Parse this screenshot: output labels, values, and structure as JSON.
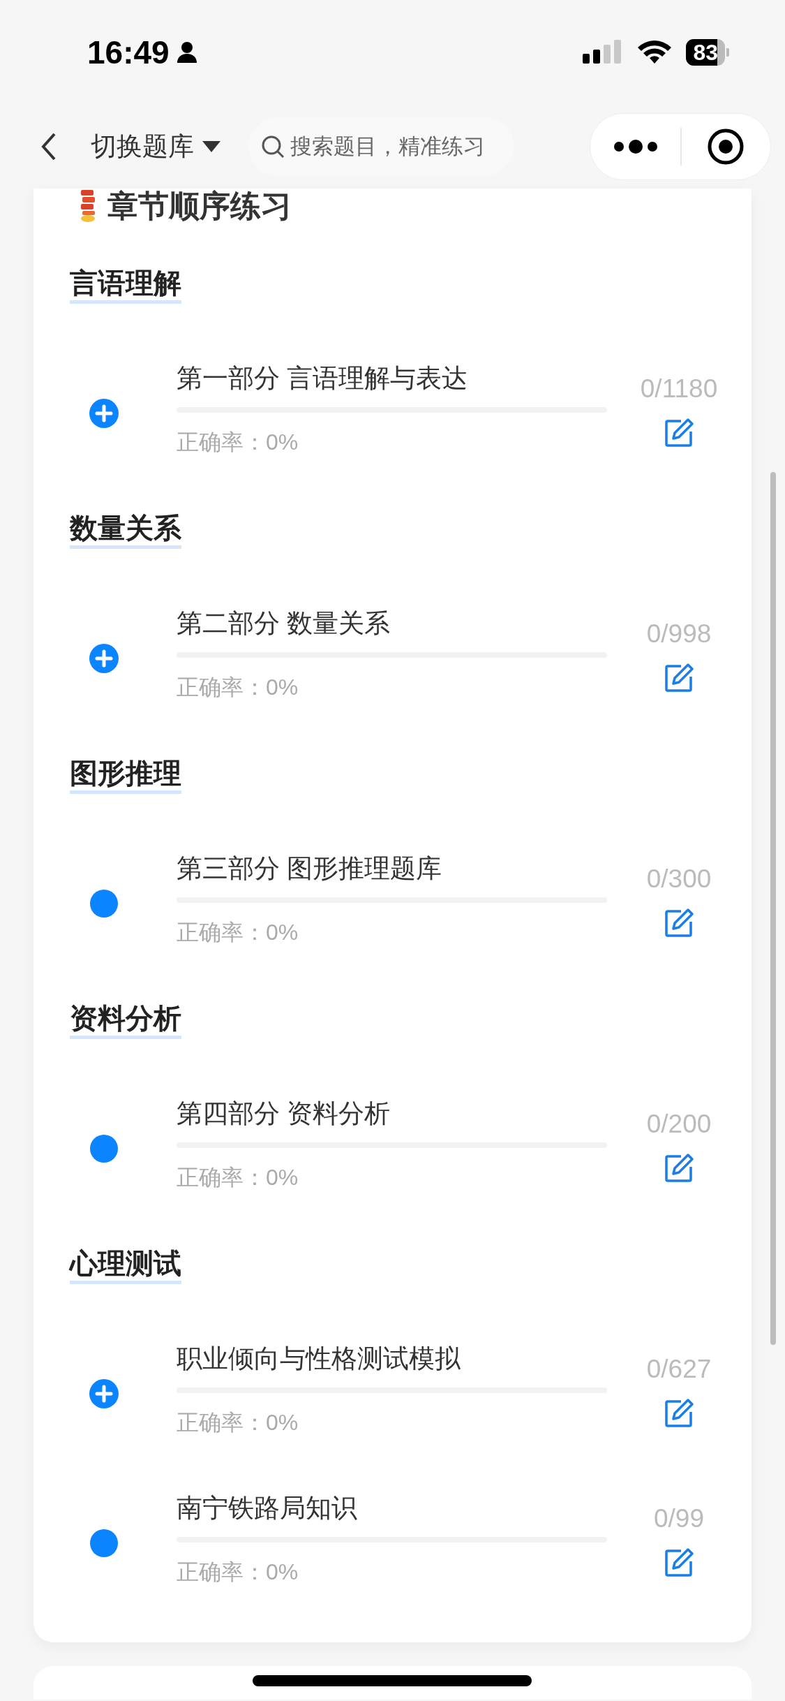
{
  "status_bar": {
    "time": "16:49",
    "battery": "83"
  },
  "nav": {
    "switch_label": "切换题库",
    "search": {
      "placeholder": "搜索题目，精准练习"
    }
  },
  "card": {
    "title": "章节顺序练习",
    "sections": [
      {
        "heading": "言语理解",
        "items": [
          {
            "title": "第一部分 言语理解与表达",
            "kind": "expandable",
            "level": 0,
            "accuracy": "正确率：0%",
            "count": "0/1180"
          }
        ]
      },
      {
        "heading": "数量关系",
        "items": [
          {
            "title": "第二部分 数量关系",
            "kind": "expandable",
            "level": 0,
            "accuracy": "正确率：0%",
            "count": "0/998"
          }
        ]
      },
      {
        "heading": "图形推理",
        "items": [
          {
            "title": "第三部分 图形推理题库",
            "kind": "leaf",
            "level": 0,
            "accuracy": "正确率：0%",
            "count": "0/300"
          }
        ]
      },
      {
        "heading": "资料分析",
        "items": [
          {
            "title": "第四部分 资料分析",
            "kind": "leaf",
            "level": 0,
            "accuracy": "正确率：0%",
            "count": "0/200"
          }
        ]
      },
      {
        "heading": "心理测试",
        "items": [
          {
            "title": "职业倾向与性格测试模拟",
            "kind": "expandable",
            "level": 0,
            "accuracy": "正确率：0%",
            "count": "0/627"
          },
          {
            "title": "南宁铁路局知识",
            "kind": "leaf",
            "level": 0,
            "accuracy": "正确率：0%",
            "count": "0/99"
          }
        ]
      }
    ]
  }
}
